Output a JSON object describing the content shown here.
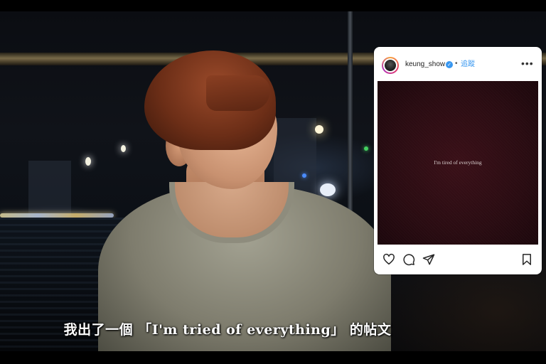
{
  "post": {
    "username": "keung_show",
    "verified_glyph": "✓",
    "separator": "•",
    "follow_label": "追蹤",
    "more_glyph": "•••",
    "image_text": "I'm tired of everything"
  },
  "icons": [
    "heart-icon",
    "comment-icon",
    "share-icon",
    "bookmark-icon"
  ],
  "subtitle": "我出了一個 「I'm tried of everything」 的帖文",
  "colors": {
    "accent": "#3897f0",
    "post_background": "#2a0c12",
    "subtitle": "#ffffff"
  }
}
